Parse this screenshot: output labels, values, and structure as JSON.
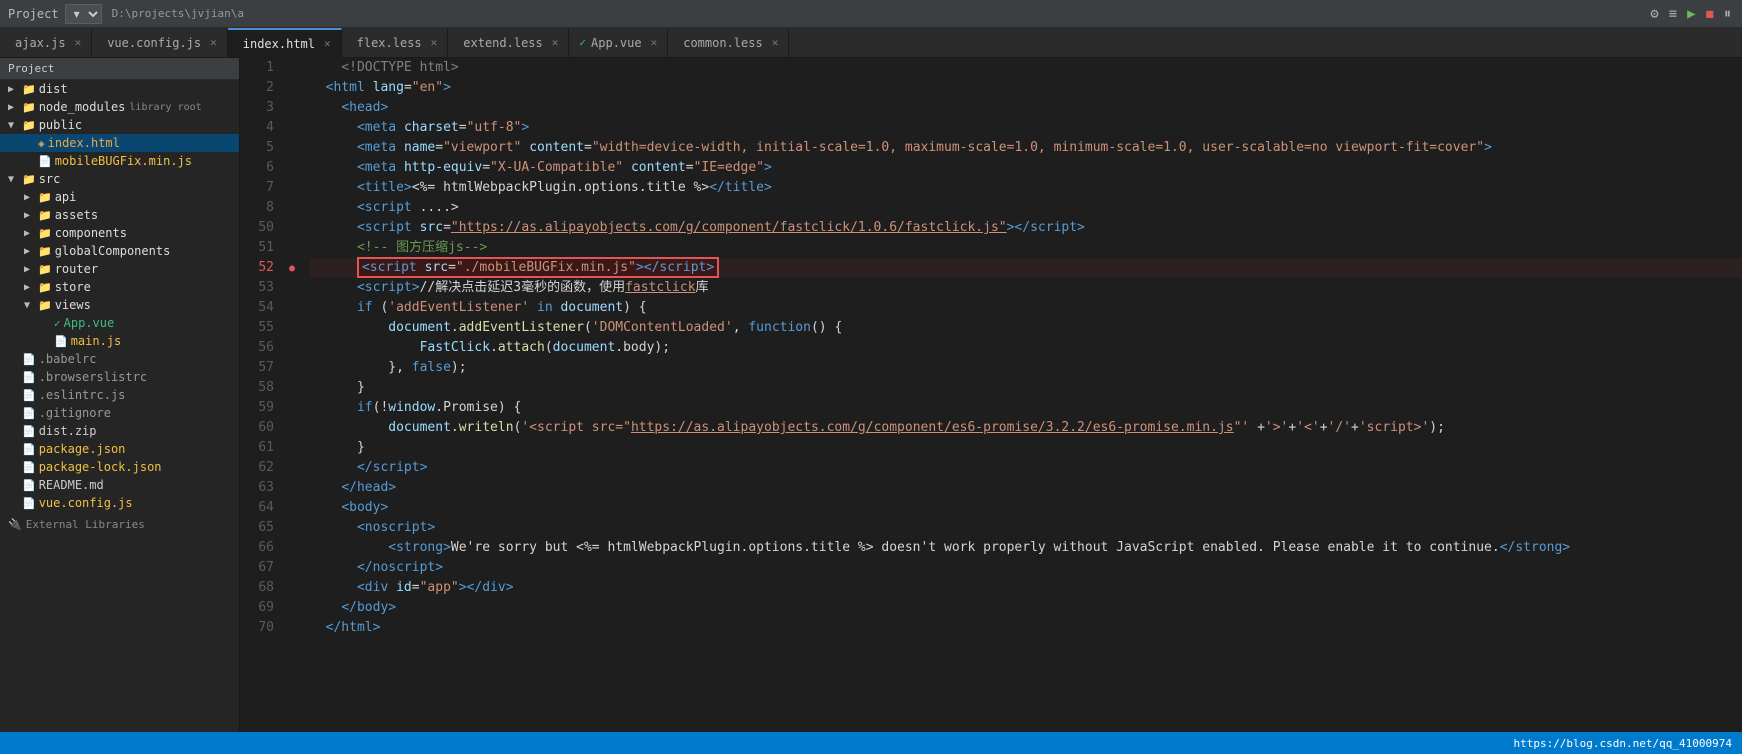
{
  "topbar": {
    "project_label": "Project",
    "dropdown_arrow": "▾",
    "path": "D:\\projects\\jvjian\\a",
    "icons": [
      "⚙",
      "≡",
      "▶",
      "◼",
      "⏸"
    ]
  },
  "tabs": [
    {
      "id": "ajax",
      "label": "ajax.js",
      "type": "js",
      "active": false
    },
    {
      "id": "vue-config",
      "label": "vue.config.js",
      "type": "js",
      "active": false
    },
    {
      "id": "index",
      "label": "index.html",
      "type": "html",
      "active": true
    },
    {
      "id": "flex",
      "label": "flex.less",
      "type": "less",
      "active": false
    },
    {
      "id": "extend",
      "label": "extend.less",
      "type": "less",
      "active": false
    },
    {
      "id": "app-vue",
      "label": "App.vue",
      "type": "vue",
      "active": false
    },
    {
      "id": "common",
      "label": "common.less",
      "type": "less",
      "active": false
    }
  ],
  "sidebar": {
    "header": "Project",
    "path": "D:\\projects\\jvjian\\a",
    "tree": [
      {
        "level": 0,
        "name": "dist",
        "type": "dir",
        "open": false,
        "arrow": "▶"
      },
      {
        "level": 0,
        "name": "node_modules",
        "type": "dir",
        "badge": "library root",
        "open": false,
        "arrow": "▶"
      },
      {
        "level": 0,
        "name": "public",
        "type": "dir",
        "open": true,
        "arrow": "▼"
      },
      {
        "level": 1,
        "name": "index.html",
        "type": "html",
        "selected": true
      },
      {
        "level": 1,
        "name": "mobileBUGFix.min.js",
        "type": "js"
      },
      {
        "level": 0,
        "name": "src",
        "type": "dir",
        "open": true,
        "arrow": "▼"
      },
      {
        "level": 1,
        "name": "api",
        "type": "dir",
        "open": false,
        "arrow": "▶"
      },
      {
        "level": 1,
        "name": "assets",
        "type": "dir",
        "open": false,
        "arrow": "▶"
      },
      {
        "level": 1,
        "name": "components",
        "type": "dir",
        "open": false,
        "arrow": "▶"
      },
      {
        "level": 1,
        "name": "globalComponents",
        "type": "dir",
        "open": false,
        "arrow": "▶"
      },
      {
        "level": 1,
        "name": "router",
        "type": "dir",
        "open": false,
        "arrow": "▶"
      },
      {
        "level": 1,
        "name": "store",
        "type": "dir",
        "open": false,
        "arrow": "▶"
      },
      {
        "level": 1,
        "name": "views",
        "type": "dir",
        "open": true,
        "arrow": "▼"
      },
      {
        "level": 2,
        "name": "App.vue",
        "type": "vue"
      },
      {
        "level": 2,
        "name": "main.js",
        "type": "js"
      },
      {
        "level": 0,
        "name": ".babelrc",
        "type": "dot"
      },
      {
        "level": 0,
        "name": ".browserslistrc",
        "type": "dot"
      },
      {
        "level": 0,
        "name": ".eslintrc.js",
        "type": "dot"
      },
      {
        "level": 0,
        "name": ".gitignore",
        "type": "dot"
      },
      {
        "level": 0,
        "name": "dist.zip",
        "type": "zip"
      },
      {
        "level": 0,
        "name": "package.json",
        "type": "json"
      },
      {
        "level": 0,
        "name": "package-lock.json",
        "type": "json"
      },
      {
        "level": 0,
        "name": "README.md",
        "type": "md"
      },
      {
        "level": 0,
        "name": "vue.config.js",
        "type": "js"
      }
    ]
  },
  "external_libs": "External Libraries",
  "code_lines": [
    {
      "num": 1,
      "content": "    &lt;!DOCTYPE html&gt;"
    },
    {
      "num": 2,
      "content": "  &lt;html lang=\"en\"&gt;"
    },
    {
      "num": 3,
      "content": "    &lt;head&gt;"
    },
    {
      "num": 4,
      "content": "      &lt;meta charset=\"utf-8\"&gt;"
    },
    {
      "num": 5,
      "content": "      &lt;meta name=\"viewport\" content=\"width=device-width, initial-scale=1.0, maximum-scale=1.0, minimum-scale=1.0, user-scalable=no viewport-fit=cover\"&gt;"
    },
    {
      "num": 6,
      "content": "      &lt;meta http-equiv=\"X-UA-Compatible\" content=\"IE=edge\"&gt;"
    },
    {
      "num": 7,
      "content": "      &lt;title&gt;&lt;%= htmlWebpackPlugin.options.title %&gt;&lt;/title&gt;"
    },
    {
      "num": 8,
      "content": "      &lt;script ....&gt;"
    },
    {
      "num": 50,
      "content": "      &lt;script src=\"https://as.alipayobjects.com/g/component/fastclick/1.0.6/fastclick.js\"&gt;&lt;/script&gt;"
    },
    {
      "num": 51,
      "content": ""
    },
    {
      "num": 52,
      "content": "      &lt;script src=\"./mobileBUGFix.min.js\"&gt;&lt;/script&gt;",
      "highlight": true,
      "breakpoint": true
    },
    {
      "num": 53,
      "content": "      &lt;script&gt;//解决点击延迟3毫秒的函数，使用fastclick库"
    },
    {
      "num": 54,
      "content": "      if ('addEventListener' in document) {"
    },
    {
      "num": 55,
      "content": "          document.addEventListener('DOMContentLoaded', function() {"
    },
    {
      "num": 56,
      "content": "              FastClick.attach(document.body);"
    },
    {
      "num": 57,
      "content": "          }, false);"
    },
    {
      "num": 58,
      "content": "      }"
    },
    {
      "num": 59,
      "content": "      if(!window.Promise) {"
    },
    {
      "num": 60,
      "content": "          document.writeln('&lt;script src=\"https://as.alipayobjects.com/g/component/es6-promise/3.2.2/es6-promise.min.js\"' +'&gt;'+'&lt;'+'/'+'script&gt;');"
    },
    {
      "num": 61,
      "content": "      }"
    },
    {
      "num": 62,
      "content": "      &lt;/script&gt;"
    },
    {
      "num": 63,
      "content": "    &lt;/head&gt;"
    },
    {
      "num": 64,
      "content": "    &lt;body&gt;"
    },
    {
      "num": 65,
      "content": "      &lt;noscript&gt;"
    },
    {
      "num": 66,
      "content": "          &lt;strong&gt;We're sorry but &lt;%= htmlWebpackPlugin.options.title %&gt; doesn't work properly without JavaScript enabled. Please enable it to continue.&lt;/strong&gt;"
    },
    {
      "num": 67,
      "content": "      &lt;/noscript&gt;"
    },
    {
      "num": 68,
      "content": "      &lt;div id=\"app\"&gt;&lt;/div&gt;"
    },
    {
      "num": 69,
      "content": "    &lt;/body&gt;"
    },
    {
      "num": 70,
      "content": "  &lt;/html&gt;"
    }
  ],
  "status_bar": {
    "url": "https://blog.csdn.net/qq_41000974"
  }
}
